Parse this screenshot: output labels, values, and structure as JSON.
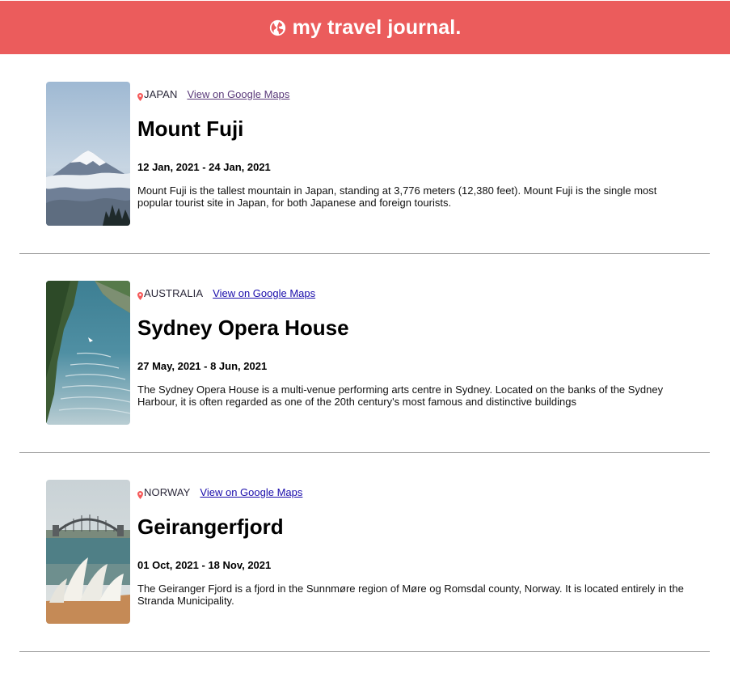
{
  "app": {
    "title": "my travel journal.",
    "icon": "globe-icon",
    "header_color": "#EB5C5C"
  },
  "entries": [
    {
      "country": "JAPAN",
      "map_link": "View on Google Maps",
      "title": "Mount Fuji",
      "dates": "12 Jan, 2021 - 24 Jan, 2021",
      "description": "Mount Fuji is the tallest mountain in Japan, standing at 3,776 meters (12,380 feet). Mount Fuji is the single most popular tourist site in Japan, for both Japanese and foreign tourists.",
      "image": "mountain-photo"
    },
    {
      "country": "AUSTRALIA",
      "map_link": "View on Google Maps",
      "title": "Sydney Opera House",
      "dates": "27 May, 2021 - 8 Jun, 2021",
      "description": "The Sydney Opera House is a multi-venue performing arts centre in Sydney. Located on the banks of the Sydney Harbour, it is often regarded as one of the 20th century's most famous and distinctive buildings",
      "image": "fjord-photo"
    },
    {
      "country": "NORWAY",
      "map_link": "View on Google Maps",
      "title": "Geirangerfjord",
      "dates": "01 Oct, 2021 - 18 Nov, 2021",
      "description": "The Geiranger Fjord is a fjord in the Sunnmøre region of Møre og Romsdal county, Norway. It is located entirely in the Stranda Municipality.",
      "image": "opera-house-photo"
    }
  ]
}
